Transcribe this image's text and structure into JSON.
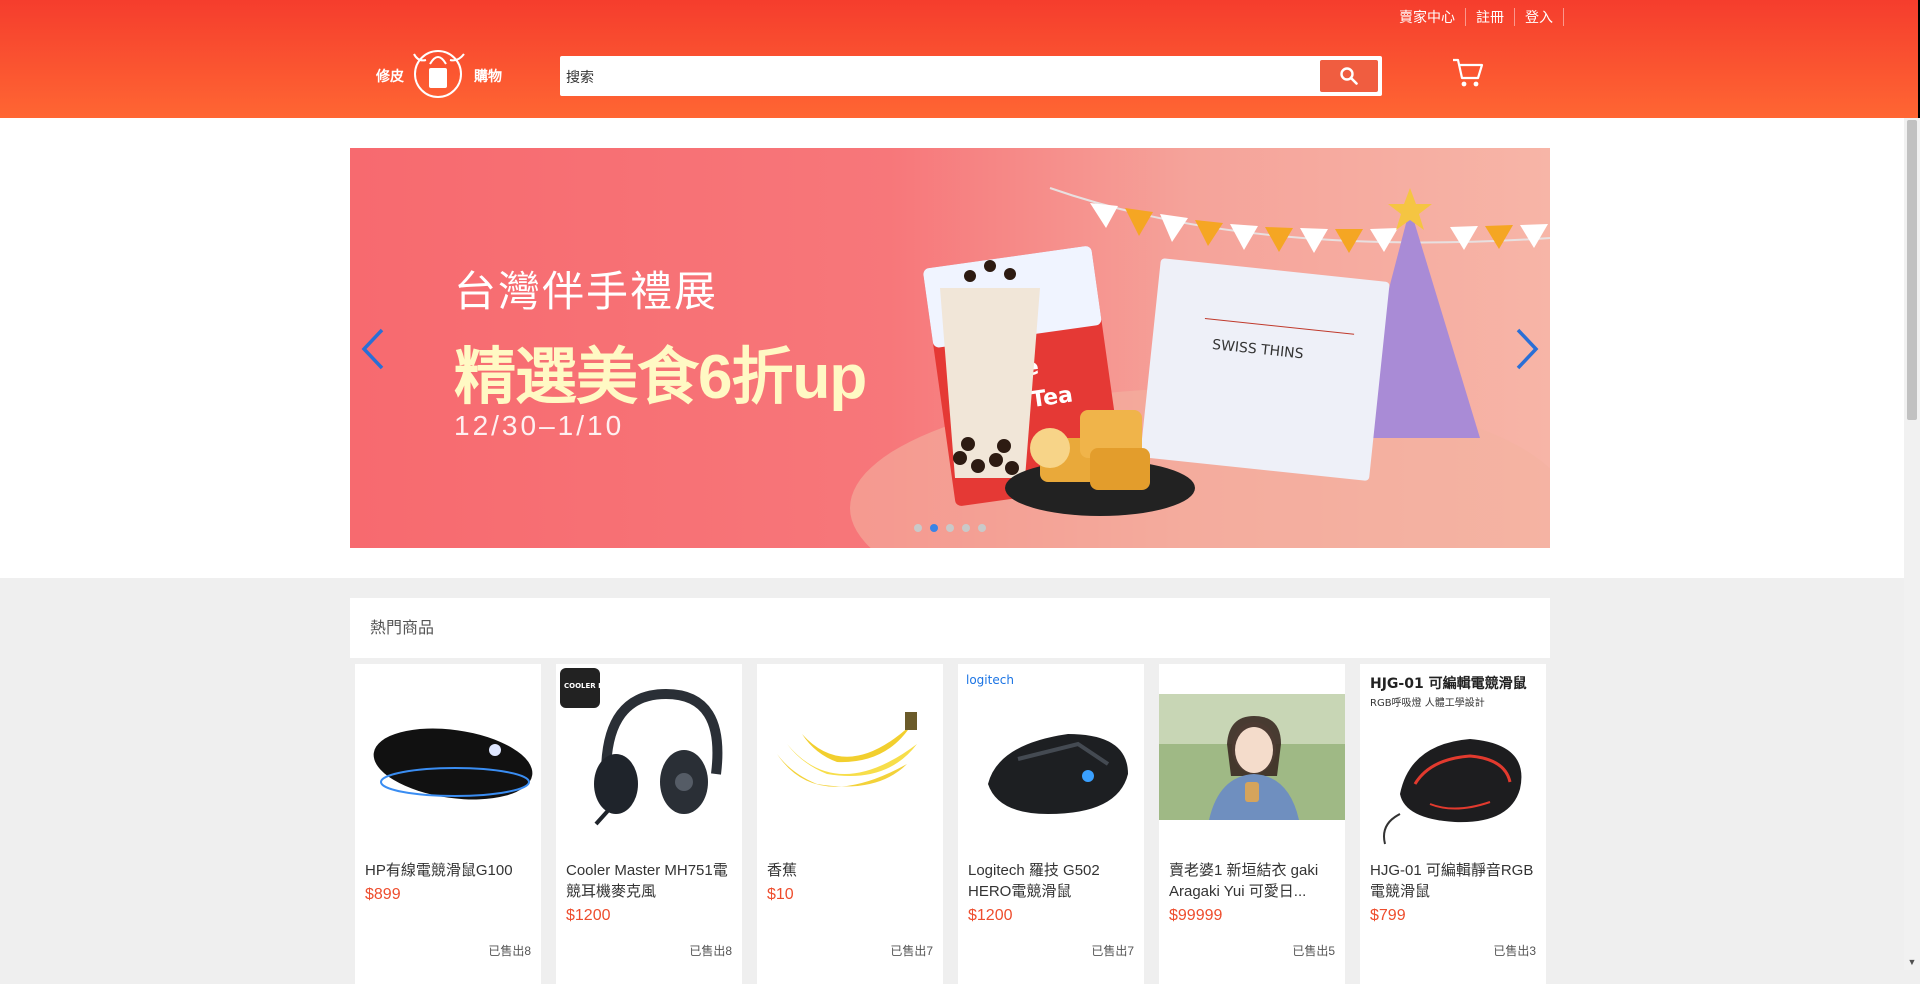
{
  "header": {
    "links": [
      "賣家中心",
      "註冊",
      "登入"
    ],
    "logo": {
      "left": "修皮",
      "right": "購物"
    },
    "search_placeholder": "搜索",
    "icons": {
      "search": "search-icon",
      "cart": "cart-icon"
    }
  },
  "banner": {
    "line1": "台灣伴手禮展",
    "line2": "精選美食6折up",
    "line3": "12/30–1/10",
    "package_label": "SWISS THINS",
    "slides": 5,
    "active_slide": 2
  },
  "hot": {
    "title": "熱門商品",
    "products": [
      {
        "name": "HP有線電競滑鼠G100",
        "price": "$899",
        "sold": "已售出8"
      },
      {
        "name": "Cooler Master MH751電競耳機麥克風",
        "price": "$1200",
        "sold": "已售出8"
      },
      {
        "name": "香蕉",
        "price": "$10",
        "sold": "已售出7"
      },
      {
        "name": "Logitech 羅技 G502 HERO電競滑鼠",
        "price": "$1200",
        "sold": "已售出7"
      },
      {
        "name": "賣老婆1 新垣結衣 gaki Aragaki Yui 可愛日...",
        "price": "$99999",
        "sold": "已售出5"
      },
      {
        "name": "HJG-01 可編輯靜音RGB電競滑鼠",
        "price": "$799",
        "sold": "已售出3"
      }
    ],
    "image_text": {
      "hjg_title": "HJG-01 可編輯電競滑鼠",
      "hjg_sub": "RGB呼吸燈 人體工學設計",
      "logitech": "logitech",
      "cooler": "COOLER MASTER"
    }
  },
  "colors": {
    "brand": "#f53d2d",
    "price": "#ee4d2d",
    "dot_active": "#3a84e6"
  }
}
